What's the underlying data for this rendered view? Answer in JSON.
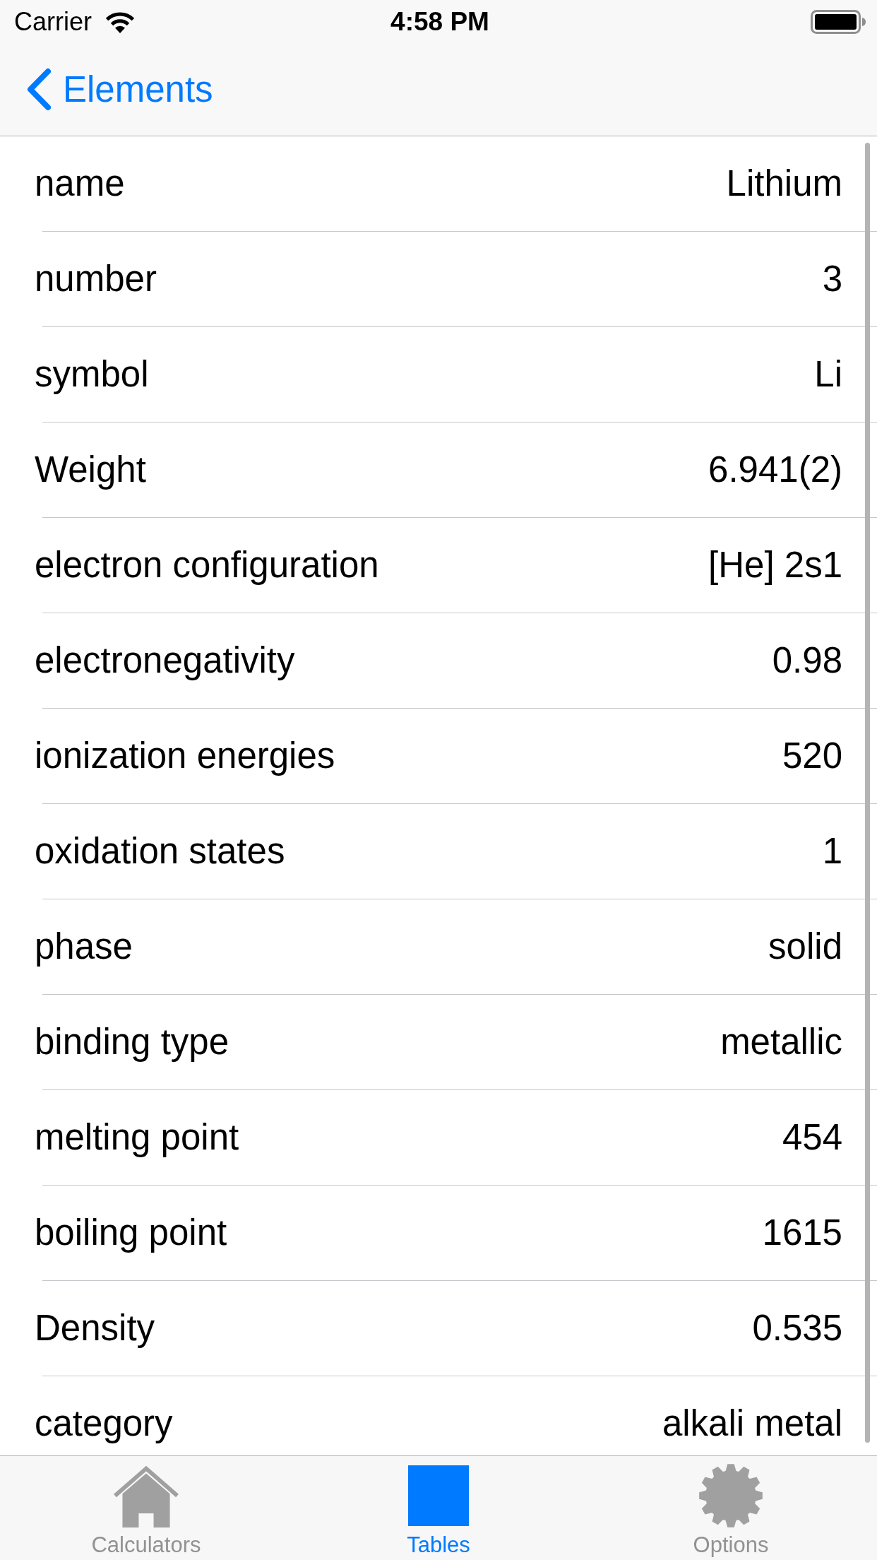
{
  "status_bar": {
    "carrier": "Carrier",
    "time": "4:58 PM"
  },
  "nav_bar": {
    "back_label": "Elements"
  },
  "rows": [
    {
      "label": "name",
      "value": "Lithium"
    },
    {
      "label": "number",
      "value": "3"
    },
    {
      "label": "symbol",
      "value": "Li"
    },
    {
      "label": "Weight",
      "value": "6.941(2)"
    },
    {
      "label": "electron configuration",
      "value": "[He] 2s1"
    },
    {
      "label": "electronegativity",
      "value": "0.98"
    },
    {
      "label": "ionization energies",
      "value": "520"
    },
    {
      "label": "oxidation states",
      "value": "1"
    },
    {
      "label": "phase",
      "value": "solid"
    },
    {
      "label": "binding type",
      "value": "metallic"
    },
    {
      "label": "melting point",
      "value": "454"
    },
    {
      "label": "boiling point",
      "value": "1615"
    },
    {
      "label": "Density",
      "value": "0.535"
    },
    {
      "label": "category",
      "value": "alkali metal"
    }
  ],
  "tab_bar": {
    "tabs": [
      {
        "label": "Calculators",
        "kind": "house",
        "selected": false
      },
      {
        "label": "Tables",
        "kind": "square",
        "selected": true
      },
      {
        "label": "Options",
        "kind": "gear",
        "selected": false
      }
    ]
  }
}
